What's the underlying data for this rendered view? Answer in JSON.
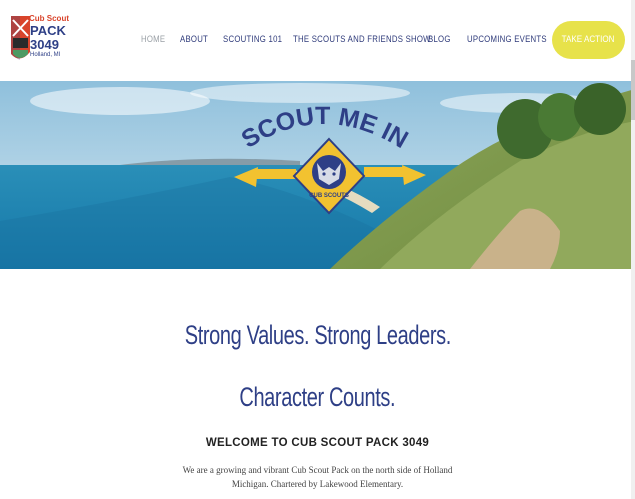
{
  "logo": {
    "line1": "Cub Scout",
    "line2": "PACK",
    "line3": "3049",
    "line4": "Holland, MI"
  },
  "nav": {
    "items": [
      {
        "label": "Home",
        "active": true
      },
      {
        "label": "About"
      },
      {
        "label": "Scouting 101"
      },
      {
        "label": "The Scouts and Friends Show"
      },
      {
        "label": "Blog"
      },
      {
        "label": "Upcoming Events"
      }
    ],
    "cta_label": "Take Action"
  },
  "hero": {
    "banner_text": "SCOUT ME IN",
    "badge_text": "CUB SCOUTS"
  },
  "main": {
    "headline1": "Strong Values.  Strong Leaders.",
    "headline2": "Character Counts.",
    "welcome": "WELCOME TO CUB SCOUT PACK 3049",
    "body": "We are a growing and vibrant Cub Scout Pack on the north side of Holland Michigan. Chartered by Lakewood Elementary."
  },
  "colors": {
    "navy": "#2e3f86",
    "cta_yellow": "#e7e24a",
    "badge_gold": "#f2c230"
  }
}
